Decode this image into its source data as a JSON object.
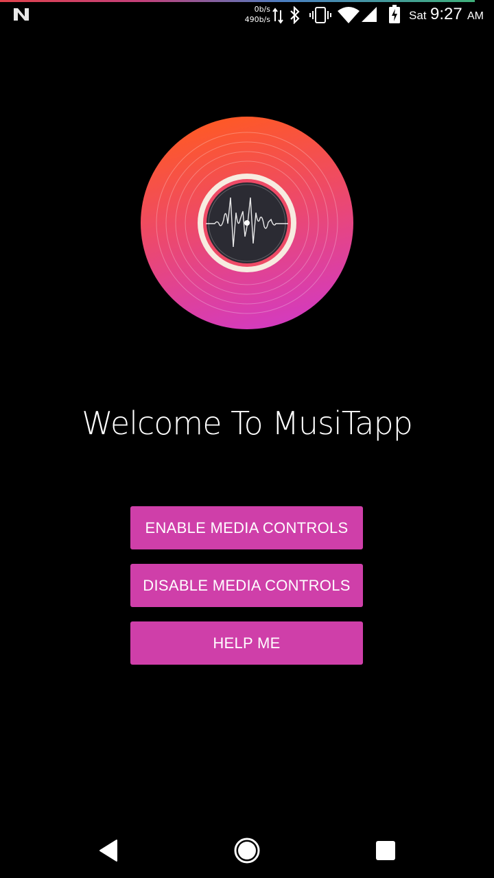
{
  "status_bar": {
    "net_speed_up": "0b/s",
    "net_speed_down": "490b/s",
    "day": "Sat",
    "time": "9:27",
    "ampm": "AM",
    "icons": [
      "n-logo-icon",
      "data-arrows-icon",
      "bluetooth-icon",
      "vibrate-icon",
      "wifi-icon",
      "cell-signal-icon",
      "battery-charging-icon"
    ]
  },
  "main": {
    "logo": "vinyl-record-waveform-icon",
    "welcome_text": "Welcome To MusiTapp",
    "buttons": {
      "enable": "ENABLE MEDIA CONTROLS",
      "disable": "DISABLE MEDIA CONTROLS",
      "help": "HELP ME"
    }
  },
  "nav_bar": {
    "icons": [
      "back-icon",
      "home-icon",
      "recents-icon"
    ]
  },
  "colors": {
    "background": "#000000",
    "button": "#cf3fa9",
    "record_top": "#ff5a2a",
    "record_bottom": "#d83bb3"
  }
}
